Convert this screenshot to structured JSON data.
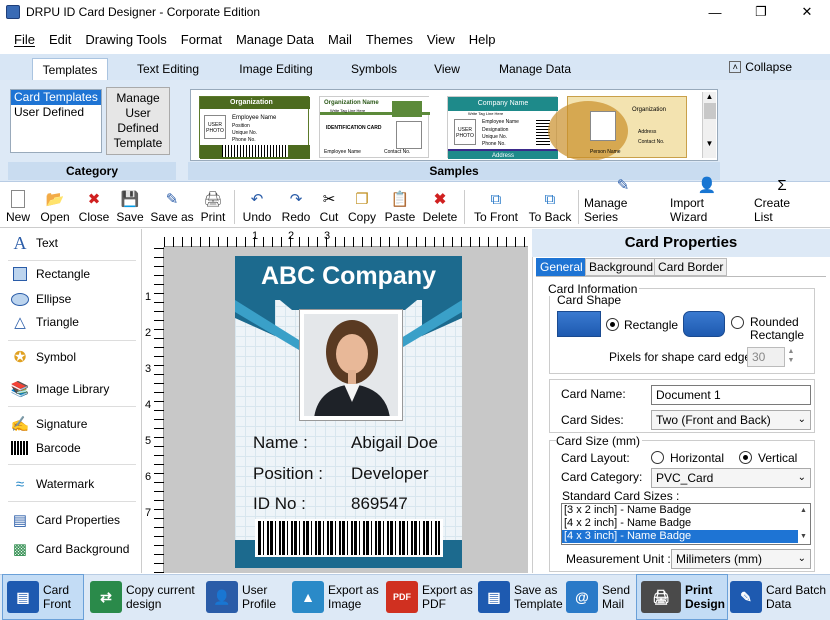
{
  "window": {
    "title": "DRPU ID Card Designer - Corporate Edition"
  },
  "menu": [
    "File",
    "Edit",
    "Drawing Tools",
    "Format",
    "Manage Data",
    "Mail",
    "Themes",
    "View",
    "Help"
  ],
  "ribbon_tabs": [
    "Templates",
    "Text Editing",
    "Image Editing",
    "Symbols",
    "View",
    "Manage Data"
  ],
  "collapse_label": "Collapse",
  "category": {
    "items": [
      "Card Templates",
      "User Defined"
    ],
    "button": "Manage User Defined Template",
    "label": "Category"
  },
  "samples": {
    "label": "Samples",
    "s1": {
      "org": "Organization",
      "name": "Employee Name",
      "pos": "Position",
      "uid": "Unique No.",
      "phone": "Phone No.",
      "photo": "USER PHOTO"
    },
    "s2": {
      "org": "Organization Name",
      "tag": "Write Tag Line Here",
      "idcard": "IDENTIFICATION CARD",
      "name": "Employee Name",
      "contact": "Contact No."
    },
    "s3": {
      "org": "Company Name",
      "tag": "Write Tag Line Here",
      "name": "Employee Name",
      "designation": "Designation",
      "uid": "Unique No.",
      "phone": "Phone No.",
      "address": "Address",
      "photo": "USER PHOTO"
    },
    "s4": {
      "org": "Organization",
      "address": "Address",
      "contact": "Contact No.",
      "person": "Person Name"
    }
  },
  "toolbar": [
    "New",
    "Open",
    "Close",
    "Save",
    "Save as",
    "Print",
    "Undo",
    "Redo",
    "Cut",
    "Copy",
    "Paste",
    "Delete",
    "To Front",
    "To Back",
    "Manage Series",
    "Import Wizard",
    "Create List"
  ],
  "left_tools": [
    "Text",
    "Rectangle",
    "Ellipse",
    "Triangle",
    "Symbol",
    "Image Library",
    "Signature",
    "Barcode",
    "Watermark",
    "Card Properties",
    "Card Background"
  ],
  "ruler": {
    "h": [
      "1",
      "2",
      "3"
    ],
    "v": [
      "1",
      "2",
      "3",
      "4",
      "5",
      "6",
      "7"
    ]
  },
  "card": {
    "company": "ABC Company",
    "fields": [
      {
        "label": "Name :",
        "value": "Abigail Doe"
      },
      {
        "label": "Position :",
        "value": "Developer"
      },
      {
        "label": "ID No :",
        "value": "869547"
      }
    ],
    "colors": {
      "primary": "#1c6a8e",
      "accent": "#3aa0c8"
    }
  },
  "properties": {
    "title": "Card Properties",
    "tabs": [
      "General",
      "Background",
      "Card Border"
    ],
    "card_info": "Card Information",
    "card_shape": "Card Shape",
    "shape_rect": "Rectangle",
    "shape_round": "Rounded Rectangle",
    "pixels_label": "Pixels for shape card edge :",
    "pixels_value": "30",
    "card_name_label": "Card Name:",
    "card_name_value": "Document 1",
    "card_sides_label": "Card Sides:",
    "card_sides_value": "Two (Front and Back)",
    "card_size": "Card Size (mm)",
    "layout_label": "Card Layout:",
    "layout_h": "Horizontal",
    "layout_v": "Vertical",
    "category_label": "Card Category:",
    "category_value": "PVC_Card",
    "std_sizes_label": "Standard Card Sizes :",
    "std_sizes": [
      "[3 x 2 inch] - Name Badge",
      "[4 x 2 inch] - Name Badge",
      "[4 x 3 inch] - Name Badge"
    ],
    "unit_label": "Measurement Unit :",
    "unit_value": "Milimeters (mm)"
  },
  "bottom": [
    {
      "l1": "Card",
      "l2": "Front"
    },
    {
      "l1": "Copy current",
      "l2": "design"
    },
    {
      "l1": "User",
      "l2": "Profile"
    },
    {
      "l1": "Export as",
      "l2": "Image"
    },
    {
      "l1": "Export as",
      "l2": "PDF"
    },
    {
      "l1": "Save as",
      "l2": "Template"
    },
    {
      "l1": "Send",
      "l2": "Mail"
    },
    {
      "l1": "Print",
      "l2": "Design"
    },
    {
      "l1": "Card Batch",
      "l2": "Data"
    }
  ]
}
